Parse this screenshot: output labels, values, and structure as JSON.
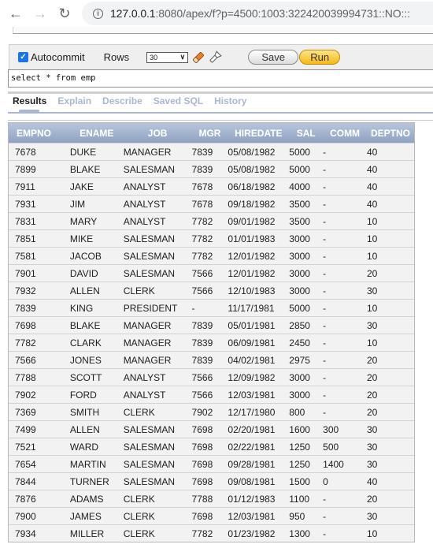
{
  "browser": {
    "url_host": "127.0.0.1",
    "url_rest": ":8080/apex/f?p=4500:1003:322420039994731::NO:::",
    "back_icon": "arrow-left",
    "forward_icon": "arrow-right",
    "reload_icon": "reload",
    "info_icon": "info-circle"
  },
  "toolbar": {
    "autocommit_label": "Autocommit",
    "autocommit_checked": true,
    "rows_label": "Rows",
    "rows_value": "30",
    "clear_icon": "eraser",
    "find_icon": "flashlight",
    "save_label": "Save",
    "run_label": "Run"
  },
  "editor": {
    "sql": "select * from emp"
  },
  "tabs": [
    {
      "label": "Results",
      "active": true
    },
    {
      "label": "Explain",
      "active": false
    },
    {
      "label": "Describe",
      "active": false
    },
    {
      "label": "Saved SQL",
      "active": false
    },
    {
      "label": "History",
      "active": false
    }
  ],
  "results": {
    "columns": [
      "EMPNO",
      "ENAME",
      "JOB",
      "MGR",
      "HIREDATE",
      "SAL",
      "COMM",
      "DEPTNO"
    ],
    "rows": [
      [
        "7678",
        "DUKE",
        "MANAGER",
        "7839",
        "05/08/1982",
        "5000",
        "-",
        "40"
      ],
      [
        "7899",
        "BLAKE",
        "SALESMAN",
        "7839",
        "05/08/1982",
        "5000",
        "-",
        "40"
      ],
      [
        "7911",
        "JAKE",
        "ANALYST",
        "7678",
        "06/18/1982",
        "4000",
        "-",
        "40"
      ],
      [
        "7931",
        "JIM",
        "ANALYST",
        "7678",
        "09/18/1982",
        "3500",
        "-",
        "40"
      ],
      [
        "7831",
        "MARY",
        "ANALYST",
        "7782",
        "09/01/1982",
        "3500",
        "-",
        "10"
      ],
      [
        "7851",
        "MIKE",
        "SALESMAN",
        "7782",
        "01/01/1983",
        "3000",
        "-",
        "10"
      ],
      [
        "7581",
        "JACOB",
        "SALESMAN",
        "7782",
        "12/01/1982",
        "3000",
        "-",
        "10"
      ],
      [
        "7901",
        "DAVID",
        "SALESMAN",
        "7566",
        "12/01/1982",
        "3000",
        "-",
        "20"
      ],
      [
        "7932",
        "ALLEN",
        "CLERK",
        "7566",
        "12/10/1983",
        "3000",
        "-",
        "30"
      ],
      [
        "7839",
        "KING",
        "PRESIDENT",
        "-",
        "11/17/1981",
        "5000",
        "-",
        "10"
      ],
      [
        "7698",
        "BLAKE",
        "MANAGER",
        "7839",
        "05/01/1981",
        "2850",
        "-",
        "30"
      ],
      [
        "7782",
        "CLARK",
        "MANAGER",
        "7839",
        "06/09/1981",
        "2450",
        "-",
        "10"
      ],
      [
        "7566",
        "JONES",
        "MANAGER",
        "7839",
        "04/02/1981",
        "2975",
        "-",
        "20"
      ],
      [
        "7788",
        "SCOTT",
        "ANALYST",
        "7566",
        "12/09/1982",
        "3000",
        "-",
        "20"
      ],
      [
        "7902",
        "FORD",
        "ANALYST",
        "7566",
        "12/03/1981",
        "3000",
        "-",
        "20"
      ],
      [
        "7369",
        "SMITH",
        "CLERK",
        "7902",
        "12/17/1980",
        "800",
        "-",
        "20"
      ],
      [
        "7499",
        "ALLEN",
        "SALESMAN",
        "7698",
        "02/20/1981",
        "1600",
        "300",
        "30"
      ],
      [
        "7521",
        "WARD",
        "SALESMAN",
        "7698",
        "02/22/1981",
        "1250",
        "500",
        "30"
      ],
      [
        "7654",
        "MARTIN",
        "SALESMAN",
        "7698",
        "09/28/1981",
        "1250",
        "1400",
        "30"
      ],
      [
        "7844",
        "TURNER",
        "SALESMAN",
        "7698",
        "09/08/1981",
        "1500",
        "0",
        "40"
      ],
      [
        "7876",
        "ADAMS",
        "CLERK",
        "7788",
        "01/12/1983",
        "1100",
        "-",
        "20"
      ],
      [
        "7900",
        "JAMES",
        "CLERK",
        "7698",
        "12/03/1981",
        "950",
        "-",
        "30"
      ],
      [
        "7934",
        "MILLER",
        "CLERK",
        "7782",
        "01/23/1982",
        "1300",
        "-",
        "10"
      ]
    ]
  },
  "colors": {
    "header_gradient_top": "#b9c6dc",
    "header_gradient_bottom": "#8ea2c3",
    "inactive_tab": "#a9b7d1",
    "run_button": "#f6b816"
  }
}
